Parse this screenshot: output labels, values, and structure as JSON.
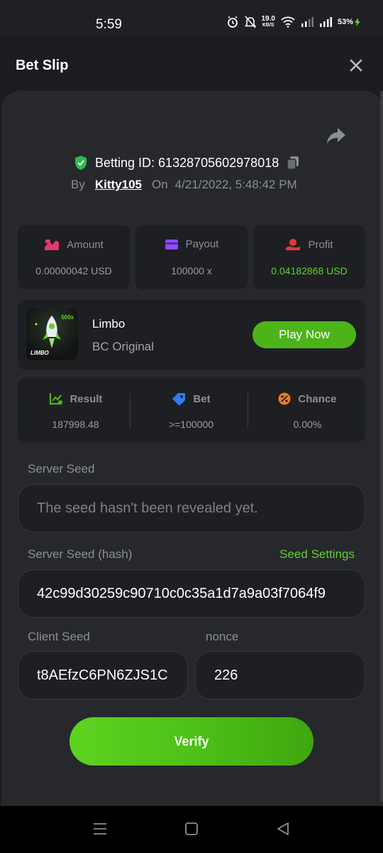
{
  "status_bar": {
    "time": "5:59",
    "net_speed_value": "19.0",
    "net_speed_unit": "KB/S",
    "battery": "53%"
  },
  "header": {
    "title": "Bet Slip"
  },
  "bet": {
    "id_text": "Betting ID: 61328705602978018",
    "by_label": "By",
    "username": "Kitty105",
    "on_label": "On",
    "datetime": "4/21/2022, 5:48:42 PM"
  },
  "stats": {
    "amount_label": "Amount",
    "amount_value": "0.00000042 USD",
    "payout_label": "Payout",
    "payout_value": "100000 x",
    "profit_label": "Profit",
    "profit_value": "0.04182868 USD"
  },
  "game": {
    "name": "Limbo",
    "subtitle": "BC Original",
    "play_label": "Play Now",
    "thumb_logo": "LIMBO",
    "thumb_badge": "500x"
  },
  "result": {
    "result_label": "Result",
    "result_value": "187998.48",
    "bet_label": "Bet",
    "bet_value": ">=100000",
    "chance_label": "Chance",
    "chance_value": "0.00%"
  },
  "seeds": {
    "server_seed_label": "Server Seed",
    "server_seed_placeholder": "The seed hasn't been revealed yet.",
    "server_hash_label": "Server Seed (hash)",
    "seed_settings_label": "Seed Settings",
    "server_hash_value": "42c99d30259c90710c0c35a1d7a9a03f7064f9",
    "client_seed_label": "Client Seed",
    "client_seed_value": "t8AEfzC6PN6ZJS1C",
    "nonce_label": "nonce",
    "nonce_value": "226"
  },
  "verify_label": "Verify",
  "colors": {
    "accent_green": "#5fd12a",
    "background": "#26282c",
    "tile": "#1e1f23"
  },
  "icons": [
    "alarm-icon",
    "bell-off-icon",
    "wifi-icon",
    "signal-icon",
    "charging-icon",
    "close-icon",
    "share-icon",
    "shield-check-icon",
    "copy-icon",
    "amount-icon",
    "payout-icon",
    "profit-icon",
    "result-icon",
    "bet-tag-icon",
    "chance-icon",
    "menu-icon",
    "home-icon",
    "back-icon"
  ]
}
